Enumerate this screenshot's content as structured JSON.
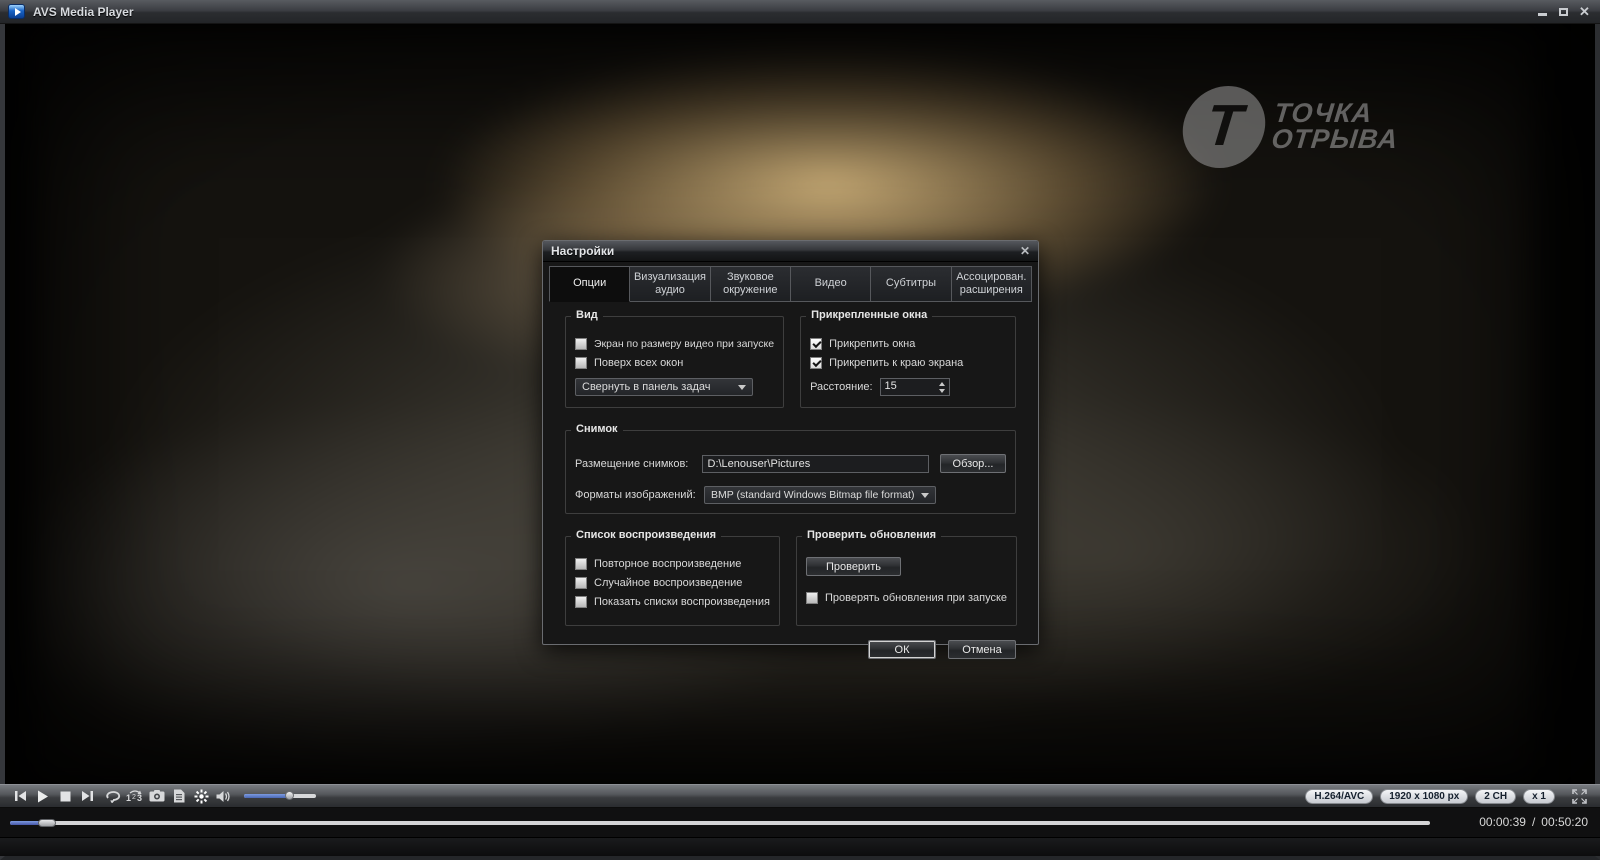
{
  "window": {
    "title": "AVS Media Player"
  },
  "watermark": {
    "letter": "T",
    "line1": "ТОЧКА",
    "line2": "ОТРЫВА"
  },
  "dialog": {
    "title": "Настройки",
    "close_glyph": "✕",
    "tabs": [
      {
        "label": "Опции"
      },
      {
        "label": "Визуализация аудио"
      },
      {
        "label": "Звуковое окружение"
      },
      {
        "label": "Видео"
      },
      {
        "label": "Субтитры"
      },
      {
        "label": "Ассоцирован. расширения"
      }
    ],
    "view": {
      "title": "Вид",
      "fit_checkbox": {
        "label": "Экран по размеру видео при запуске",
        "checked": false
      },
      "ontop_checkbox": {
        "label": "Поверх всех окон",
        "checked": false
      },
      "minimize_select": {
        "value": "Свернуть в панель задач"
      }
    },
    "docked": {
      "title": "Прикрепленные окна",
      "dock_checkbox": {
        "label": "Прикрепить окна",
        "checked": true
      },
      "edge_checkbox": {
        "label": "Прикрепить к краю экрана",
        "checked": true
      },
      "distance_label": "Расстояние:",
      "distance_value": "15"
    },
    "snapshot": {
      "title": "Снимок",
      "location_label": "Размещение снимков:",
      "location_value": "D:\\Lenouser\\Pictures",
      "browse_label": "Обзор...",
      "format_label": "Форматы изображений:",
      "format_value": "BMP (standard Windows Bitmap file format)"
    },
    "playlist": {
      "title": "Список воспроизведения",
      "repeat_checkbox": {
        "label": "Повторное воспроизведение",
        "checked": false
      },
      "shuffle_checkbox": {
        "label": "Случайное воспроизведение",
        "checked": false
      },
      "show_checkbox": {
        "label": "Показать списки воспроизведения",
        "checked": false
      }
    },
    "updates": {
      "title": "Проверить обновления",
      "check_button": "Проверить",
      "startup_checkbox": {
        "label": "Проверять обновления при запуске",
        "checked": false
      }
    },
    "ok_label": "ОК",
    "cancel_label": "Отмена"
  },
  "status": {
    "codec": "H.264/AVC",
    "resolution": "1920 x 1080 px",
    "channels": "2 CH",
    "rate": "x 1"
  },
  "timeline": {
    "elapsed": "00:00:39",
    "separator": "/",
    "duration": "00:50:20"
  }
}
